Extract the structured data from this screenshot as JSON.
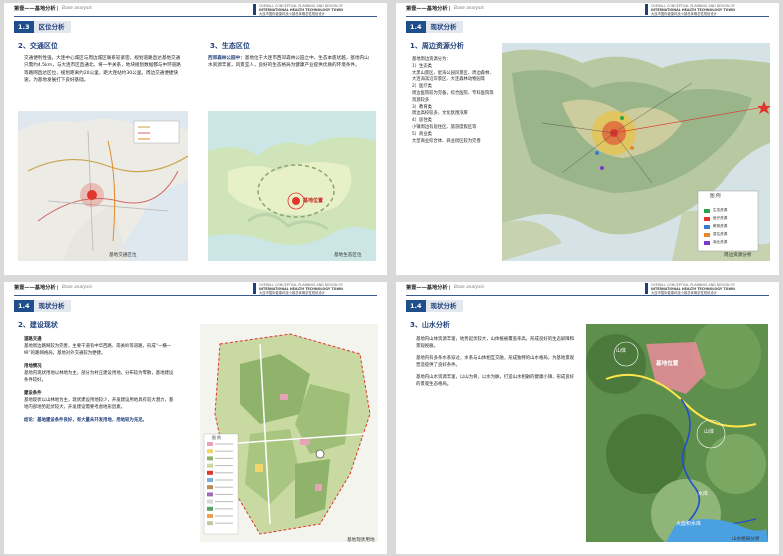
{
  "header": {
    "chapter": "第壹——基地分析",
    "chapter_en": "Base analysis",
    "project_l1": "OVERALL CONCEPTUAL PLANNING AND DESIGN OF",
    "project_l2": "INTERNATIONAL HEALTH TECHNOLOGY TOWN",
    "project_l3": "大连市国际健康科技小镇总体概念性规划设计"
  },
  "page1": {
    "tag_num": "1.3",
    "tag_title": "区位分析",
    "traffic_heading": "2、交通区位",
    "traffic_text": "交通便利性强，大连中心城区与周边城区联系较紧密。规划道路直达基地交通只需约4.5km，与大连市区直通北、将一半关系，地块规划数据都与中环道路等路网直达区位，规划距离约20公里，距大连站约30公里。周边交通便捷快速，为基地发展打下良好基础。",
    "eco_heading": "3、生态区位",
    "eco_label": "西郊森林公园中：",
    "eco_text": "基地位于大连市西郊森林公园之中，生态本底优越，基地内山水资源丰富，风景宜人，良好的生态格局为健康产业提供优质的环境条件。",
    "traffic_caption": "基地交通区位",
    "eco_caption": "基地生态区位",
    "eco_marker": "基地位置"
  },
  "page2": {
    "tag_num": "1.4",
    "tag_title": "现状分析",
    "heading": "1、周边资源分析",
    "intro": "基地周边资源分为：",
    "items": [
      "1）生态类",
      "大黑山景区、星海公园风景区、周边森林、大连海滨沿岸景区、大连森林动物园等",
      "2）医疗类",
      "周边医院较为完备，综合医院、专科医院等资源较多",
      "3）教育类",
      "周边高校较多，文化氛围浓厚",
      "4）居住类",
      "小镇周边有居住区、旅游度假区等",
      "5）商业类",
      "大型商业综合体、商业街区较为完善"
    ],
    "legend_title": "图  例",
    "legend_items": [
      "生态资源",
      "医疗资源",
      "教育资源",
      "居住资源",
      "商业资源"
    ],
    "caption": "周边资源分析"
  },
  "page3": {
    "tag_num": "1.4",
    "tag_title": "现状分析",
    "heading": "2、建设现状",
    "blocks": [
      {
        "title": "道路交通",
        "body": "基地周边路网较为完善，主要干道有中华西路、南关岭等道路，形成“一横一纵”的路网格局，基地对外交通较为便捷。"
      },
      {
        "title": "用地情况",
        "body": "基地内现状用地以林地为主，部分为村庄建设用地，分布较为零散，基地建设条件较好。"
      },
      {
        "title": "建设条件",
        "body": "基地现状以山林地为主，现状建设用地较少，开发建设用地具有较大潜力，基地内部地势起伏较大，开发建设需要考虑地形因素。"
      }
    ],
    "summary": "结论：基地建设条件良好，有大量未开发用地，用地较为充足。",
    "legend_title": "图  例",
    "caption": "基地现状用地"
  },
  "page4": {
    "tag_num": "1.4",
    "tag_title": "现状分析",
    "heading": "3、山水分析",
    "paras": [
      "基地内山体资源丰富，地势起伏较大，山体植被覆盖率高，形成良好的生态屏障和景观视廊。",
      "基地内有多条水系穿过，水系与山体相互交融，形成独特的山水格局，为基地景观营造提供了良好条件。",
      "基地内山水资源丰富，以山为骨，以水为脉，打造山水相融的健康小镇，形成良好的景观生态格局。"
    ],
    "labels": [
      "山体",
      "基地位置",
      "山体",
      "水库",
      "大面积水库"
    ],
    "caption": "山水格局分析"
  },
  "colors": {
    "brand": "#1f3f7a",
    "accent": "#1f4e8c",
    "site_red": "#e0362c"
  }
}
